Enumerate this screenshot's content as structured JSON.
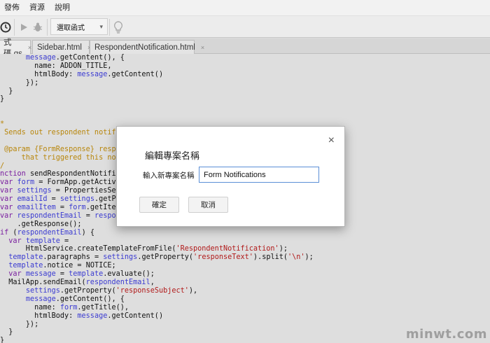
{
  "menu": [
    "發佈",
    "資源",
    "說明"
  ],
  "toolbar": {
    "function_select": "選取函式"
  },
  "tabs": [
    {
      "label": "式碼.gs",
      "close": "×"
    },
    {
      "label": "Sidebar.html",
      "close": "×"
    },
    {
      "label": "RespondentNotification.html",
      "close": "×"
    }
  ],
  "code_lines": [
    "      message.getContent(), {",
    "        name: ADDON_TITLE,",
    "        htmlBody: message.getContent()",
    "      });",
    "  }",
    "}",
    "",
    "",
    "*",
    " Sends out respondent notifica",
    "",
    " @param {FormResponse} response",
    "     that triggered this notif",
    "/",
    "nction sendRespondentNotificat",
    "var form = FormApp.getActiveFor",
    "var settings = PropertiesServic",
    "var emailId = settings.getPrope",
    "var emailItem = form.getItemBy",
    "var respondentEmail = response.",
    "    .getResponse();",
    "if (respondentEmail) {",
    "  var template =",
    "      HtmlService.createTemplateFromFile('RespondentNotification');",
    "  template.paragraphs = settings.getProperty('responseText').split('\\n');",
    "  template.notice = NOTICE;",
    "  var message = template.evaluate();",
    "  MailApp.sendEmail(respondentEmail,",
    "      settings.getProperty('responseSubject'),",
    "      message.getContent(), {",
    "        name: form.getTitle(),",
    "        htmlBody: message.getContent()",
    "      });",
    "  }",
    "}"
  ],
  "dialog": {
    "title": "編輯專案名稱",
    "close_glyph": "×",
    "label": "輸入新專案名稱",
    "input_value": "Form Notifications",
    "ok_label": "確定",
    "cancel_label": "取消"
  },
  "watermark": "minwt.com",
  "colors": {
    "accent_border": "#5b8fd6",
    "keyword": "#7a1fa0",
    "string": "#b11a1a",
    "comment": "#b8860b"
  }
}
